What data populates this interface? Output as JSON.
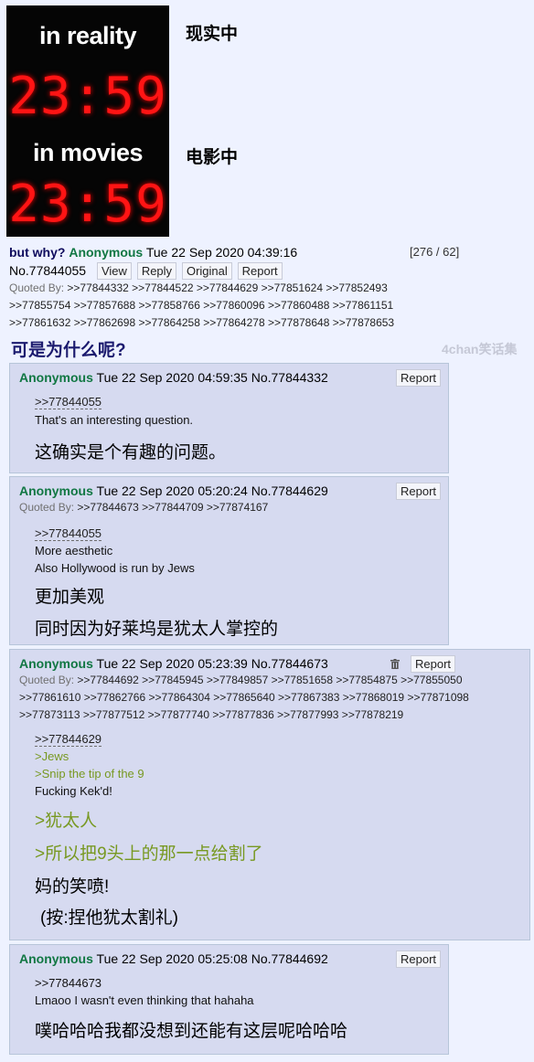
{
  "op_image": {
    "caption_reality": "in reality",
    "clock_reality": "23:59",
    "caption_movies": "in movies",
    "clock_movies": "23:59"
  },
  "labels": {
    "reality_zh": "现实中",
    "movies_zh": "电影中"
  },
  "op": {
    "subject": "but why?",
    "name": "Anonymous",
    "datetime": "Tue 22 Sep 2020 04:39:16",
    "number": "No.77844055",
    "count": "[276 / 62]",
    "buttons": [
      "View",
      "Reply",
      "Original",
      "Report"
    ],
    "quoted_by_label": "Quoted By:",
    "quoted_line1": ">>77844332 >>77844522 >>77844629 >>77851624 >>77852493",
    "quoted_line2": ">>77855754 >>77857688 >>77858766 >>77860096 >>77860488 >>77861151",
    "quoted_line3": ">>77861632 >>77862698 >>77864258 >>77864278 >>77878648 >>77878653",
    "title_zh": "可是为什么呢?",
    "watermark": "4chan笑话集"
  },
  "replies": [
    {
      "name": "Anonymous",
      "meta": "Tue 22 Sep 2020 04:59:35 No.77844332",
      "report": "Report",
      "quote": ">>77844055",
      "text1": "That's an interesting question.",
      "zh1": "这确实是个有趣的问题。"
    },
    {
      "name": "Anonymous",
      "meta": "Tue 22 Sep 2020 05:20:24 No.77844629",
      "report": "Report",
      "quoted_by_label": "Quoted By:",
      "quoted_line1": ">>77844673 >>77844709 >>77874167",
      "quote": ">>77844055",
      "text1": "More aesthetic",
      "text2": "Also Hollywood is run by Jews",
      "zh1": "更加美观",
      "zh2": "同时因为好莱坞是犹太人掌控的"
    },
    {
      "name": "Anonymous",
      "meta": "Tue 22 Sep 2020 05:23:39 No.77844673",
      "report": "Report",
      "quoted_by_label": "Quoted By:",
      "quoted_line1": ">>77844692 >>77845945 >>77849857 >>77851658 >>77854875 >>77855050",
      "quoted_line2": ">>77861610 >>77862766 >>77864304 >>77865640 >>77867383 >>77868019 >>77871098",
      "quoted_line3": ">>77873113 >>77877512 >>77877740 >>77877836 >>77877993 >>77878219",
      "quote": ">>77844629",
      "green1": ">Jews",
      "green2": ">Snip the tip of the 9",
      "text1": "Fucking Kek'd!",
      "zh_green1": ">犹太人",
      "zh_green2": ">所以把9头上的那一点给割了",
      "zh1": "妈的笑喷!",
      "zh2": "(按:捏他犹太割礼)"
    },
    {
      "name": "Anonymous",
      "meta": "Tue 22 Sep 2020 05:25:08 No.77844692",
      "report": "Report",
      "quote": ">>77844673",
      "text1": "Lmaoo I wasn't even thinking that hahaha",
      "zh1": "噗哈哈哈我都没想到还能有这层呢哈哈哈"
    }
  ]
}
